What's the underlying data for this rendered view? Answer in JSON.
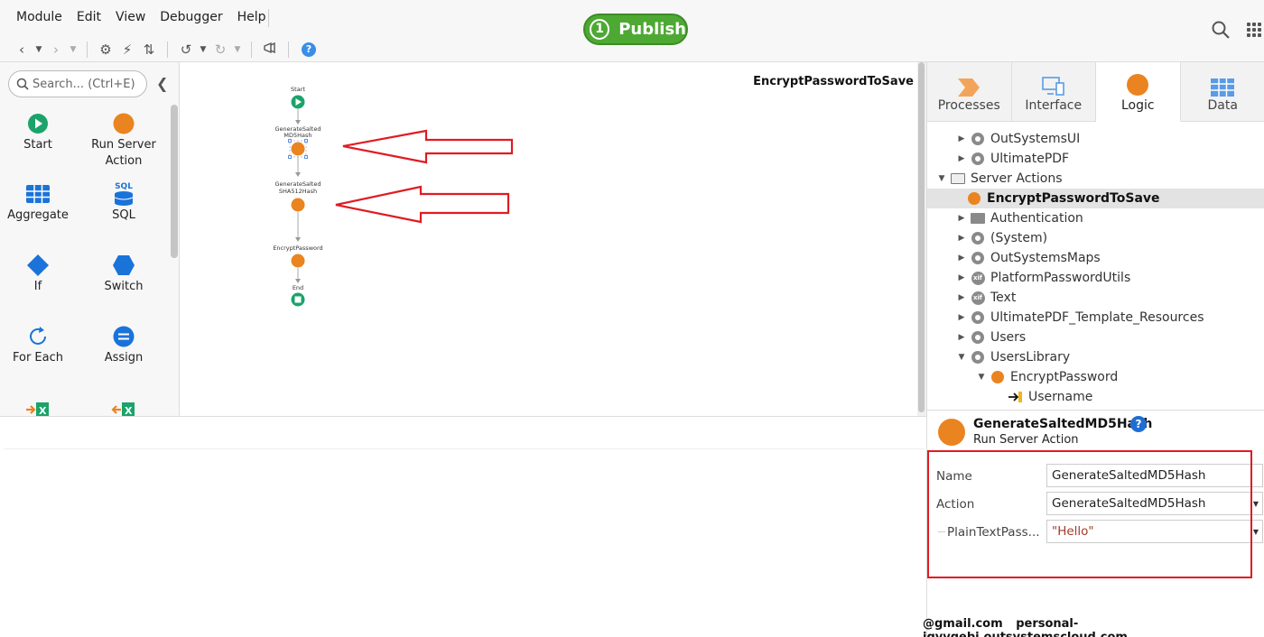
{
  "menu": [
    "Module",
    "Edit",
    "View",
    "Debugger",
    "Help"
  ],
  "publish": {
    "number": "1",
    "label": "Publish"
  },
  "toolbox": {
    "search_placeholder": "Search... (Ctrl+E)",
    "tools": [
      {
        "label": "Start"
      },
      {
        "label": "Run Server Action"
      },
      {
        "label": "Aggregate"
      },
      {
        "label": "SQL",
        "icon_text": "SQL"
      },
      {
        "label": "If"
      },
      {
        "label": "Switch"
      },
      {
        "label": "For Each"
      },
      {
        "label": "Assign"
      }
    ]
  },
  "canvas": {
    "title": "EncryptPasswordToSave",
    "nodes": [
      {
        "label1": "Start",
        "label2": ""
      },
      {
        "label1": "GenerateSalted",
        "label2": "MD5Hash"
      },
      {
        "label1": "GenerateSalted",
        "label2": "SHA512Hash"
      },
      {
        "label1": "EncryptPassword",
        "label2": ""
      },
      {
        "label1": "End",
        "label2": ""
      }
    ]
  },
  "tabs": [
    {
      "label": "Processes"
    },
    {
      "label": "Interface"
    },
    {
      "label": "Logic"
    },
    {
      "label": "Data"
    }
  ],
  "tree": [
    {
      "label": "OutSystemsUI"
    },
    {
      "label": "UltimatePDF"
    },
    {
      "label": "Server Actions"
    },
    {
      "label": "EncryptPasswordToSave"
    },
    {
      "label": "Authentication"
    },
    {
      "label": "(System)"
    },
    {
      "label": "OutSystemsMaps"
    },
    {
      "label": "PlatformPasswordUtils",
      "icon_text": "xif"
    },
    {
      "label": "Text",
      "icon_text": "xif"
    },
    {
      "label": "UltimatePDF_Template_Resources"
    },
    {
      "label": "Users"
    },
    {
      "label": "UsersLibrary"
    },
    {
      "label": "EncryptPassword"
    },
    {
      "label": "Username"
    }
  ],
  "properties": {
    "title": "GenerateSaltedMD5Hash",
    "help": "?",
    "subtitle": "Run Server Action",
    "rows": [
      {
        "label": "Name",
        "value": "GenerateSaltedMD5Hash"
      },
      {
        "label": "Action",
        "value": "GenerateSaltedMD5Hash"
      },
      {
        "label": "PlainTextPass...",
        "value": "\"Hello\""
      }
    ]
  },
  "status": {
    "email": "@gmail.com",
    "server": "personal-igyvqebj.outsystemscloud.com"
  },
  "colors": {
    "publish_green": "#4da933",
    "action_orange": "#ea8420",
    "start_green": "#1ba36a",
    "highlight_red": "#e01b22"
  }
}
